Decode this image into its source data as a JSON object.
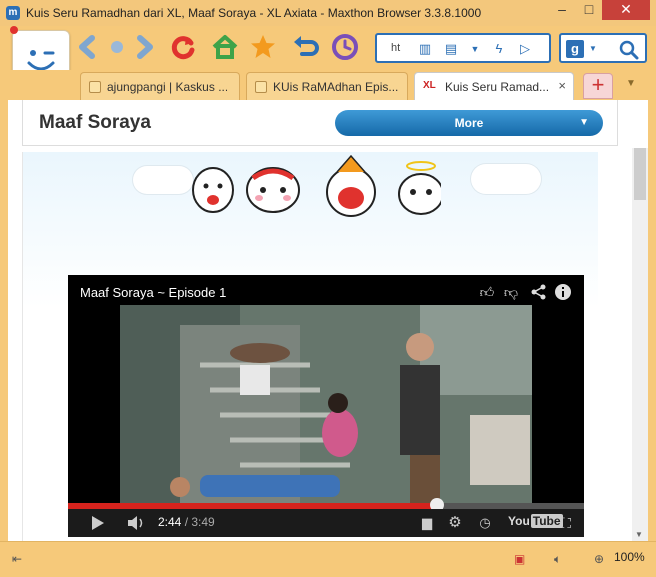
{
  "window": {
    "title": "Kuis Seru Ramadhan dari XL, Maaf Soraya - XL Axiata - Maxthon Browser 3.3.8.1000",
    "app_icon": "m",
    "minimize": "–",
    "maximize": "□",
    "close": "✕"
  },
  "toolbar": {
    "address_text": "ht",
    "search_engine": "g"
  },
  "tabs": [
    {
      "label": "ajungpangi | Kaskus ...",
      "active": false
    },
    {
      "label": "KUis RaMAdhan Epis...",
      "active": false
    },
    {
      "label": "Kuis Seru Ramad...",
      "active": true,
      "favicon": "XL"
    }
  ],
  "newtab_label": "+",
  "page": {
    "title": "Maaf Soraya",
    "more_label": "More"
  },
  "video": {
    "title": "Maaf Soraya ~ Episode 1",
    "current_time": "2:44",
    "duration": "/ 3:49",
    "progress_fraction": 0.716,
    "brand_left": "You",
    "brand_right": "Tube"
  },
  "statusbar": {
    "zoom": "100%"
  },
  "colors": {
    "chrome": "#f6c97a",
    "accent": "#2c6fb5",
    "yt_red": "#d6231d"
  }
}
